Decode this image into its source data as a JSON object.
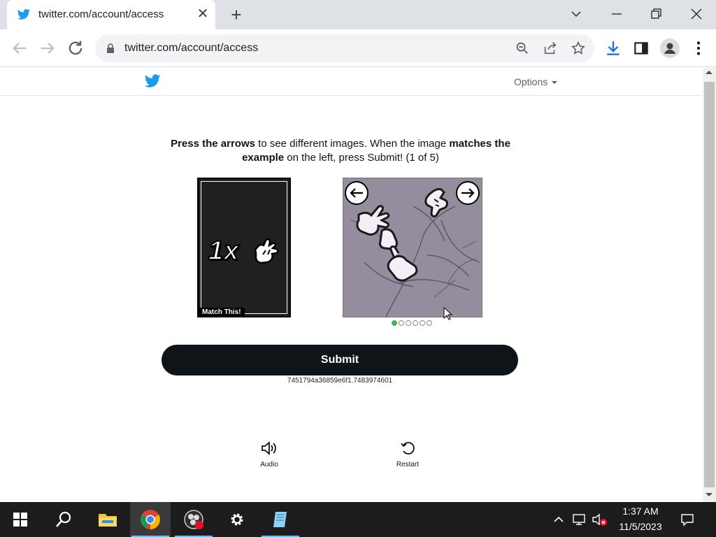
{
  "browser": {
    "tab_title": "twitter.com/account/access",
    "tab_close": "✕",
    "new_tab": "+",
    "url": "twitter.com/account/access"
  },
  "page": {
    "options_label": "Options",
    "instructions": {
      "part1_bold": "Press the arrows",
      "part2": " to see different images. When the image ",
      "part3_bold": "matches the example",
      "part4": " on the left, press Submit! (1 of 5)"
    },
    "example": {
      "text": "1x",
      "label": "Match This!"
    },
    "pagination": {
      "total": 6,
      "active_index": 0
    },
    "submit_label": "Submit",
    "session_id": "7451794a36859e6f1.7483974601",
    "audio_label": "Audio",
    "restart_label": "Restart"
  },
  "taskbar": {
    "time": "1:37 AM",
    "date": "11/5/2023"
  },
  "colors": {
    "twitter_blue": "#1d9bf0",
    "submit_bg": "#0f1419",
    "active_dot": "#4caf50",
    "taskbar_bg": "#1c1c1c"
  },
  "icons": [
    "twitter-icon",
    "back-icon",
    "forward-icon",
    "reload-icon",
    "lock-icon",
    "zoom-icon",
    "share-icon",
    "star-icon",
    "download-icon",
    "sidepanel-icon",
    "profile-icon",
    "menu-icon",
    "arrow-left-icon",
    "arrow-right-icon",
    "speaker-icon",
    "restart-icon",
    "windows-start-icon",
    "search-icon",
    "file-explorer-icon",
    "chrome-icon",
    "obs-icon",
    "settings-icon",
    "notepad-icon",
    "chevron-up-icon",
    "network-icon",
    "volume-muted-icon",
    "notification-icon"
  ]
}
